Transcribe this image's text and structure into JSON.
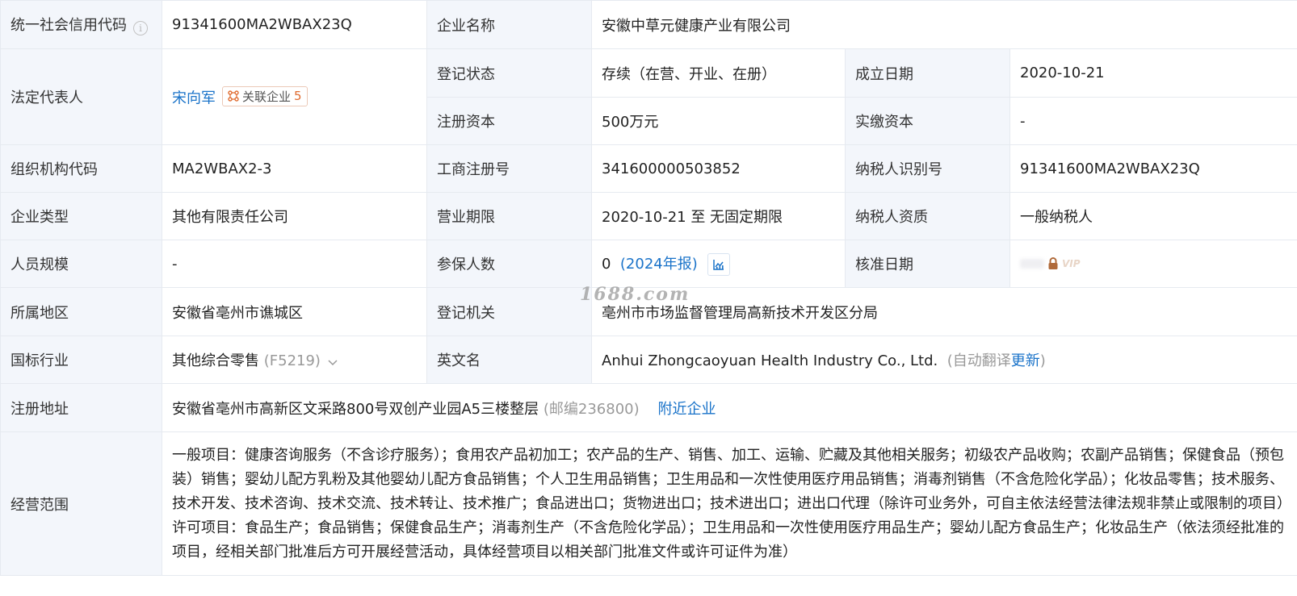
{
  "credit_code": {
    "label": "统一社会信用代码",
    "value": "91341600MA2WBAX23Q"
  },
  "company_name": {
    "label": "企业名称",
    "value": "安徽中草元健康产业有限公司"
  },
  "legal_rep": {
    "label": "法定代表人",
    "name": "宋向军",
    "related_label": "关联企业",
    "related_count": "5"
  },
  "reg_status": {
    "label": "登记状态",
    "value": "存续（在营、开业、在册）"
  },
  "founded": {
    "label": "成立日期",
    "value": "2020-10-21"
  },
  "reg_capital": {
    "label": "注册资本",
    "value": "500万元"
  },
  "paid_capital": {
    "label": "实缴资本",
    "value": "-"
  },
  "org_code": {
    "label": "组织机构代码",
    "value": "MA2WBAX2-3"
  },
  "biz_reg_no": {
    "label": "工商注册号",
    "value": "341600000503852"
  },
  "taxpayer_id": {
    "label": "纳税人识别号",
    "value": "91341600MA2WBAX23Q"
  },
  "company_type": {
    "label": "企业类型",
    "value": "其他有限责任公司"
  },
  "biz_term": {
    "label": "营业期限",
    "value": "2020-10-21 至 无固定期限"
  },
  "taxpayer_qual": {
    "label": "纳税人资质",
    "value": "一般纳税人"
  },
  "staff_size": {
    "label": "人员规模",
    "value": "-"
  },
  "insured": {
    "label": "参保人数",
    "value": "0",
    "report": "(2024年报)"
  },
  "approval_date": {
    "label": "核准日期",
    "vip": "VIP"
  },
  "region": {
    "label": "所属地区",
    "value": "安徽省亳州市谯城区"
  },
  "reg_authority": {
    "label": "登记机关",
    "value": "亳州市市场监督管理局高新技术开发区分局"
  },
  "industry": {
    "label": "国标行业",
    "value": "其他综合零售",
    "code": "(F5219)"
  },
  "english_name": {
    "label": "英文名",
    "value": "Anhui Zhongcaoyuan Health Industry Co., Ltd.",
    "auto_prefix": "(自动翻译",
    "update": "更新",
    "auto_suffix": ")"
  },
  "address": {
    "label": "注册地址",
    "value": "安徽省亳州市高新区文采路800号双创产业园A5三楼整层",
    "postcode": "(邮编236800)",
    "nearby": "附近企业"
  },
  "scope": {
    "label": "经营范围",
    "value": "一般项目：健康咨询服务（不含诊疗服务）；食用农产品初加工；农产品的生产、销售、加工、运输、贮藏及其他相关服务；初级农产品收购；农副产品销售；保健食品（预包装）销售；婴幼儿配方乳粉及其他婴幼儿配方食品销售；个人卫生用品销售；卫生用品和一次性使用医疗用品销售；消毒剂销售（不含危险化学品）；化妆品零售；技术服务、技术开发、技术咨询、技术交流、技术转让、技术推广；食品进出口；货物进出口；技术进出口；进出口代理（除许可业务外，可自主依法经营法律法规非禁止或限制的项目）许可项目：食品生产；食品销售；保健食品生产；消毒剂生产（不含危险化学品）；卫生用品和一次性使用医疗用品生产；婴幼儿配方食品生产；化妆品生产（依法须经批准的项目，经相关部门批准后方可开展经营活动，具体经营项目以相关部门批准文件或许可证件为准）"
  },
  "watermark": "1688.com",
  "colors": {
    "label_bg": "#f3f6fb",
    "border": "#e6eaf0",
    "link": "#1a73c9",
    "accent": "#e06b2f"
  }
}
